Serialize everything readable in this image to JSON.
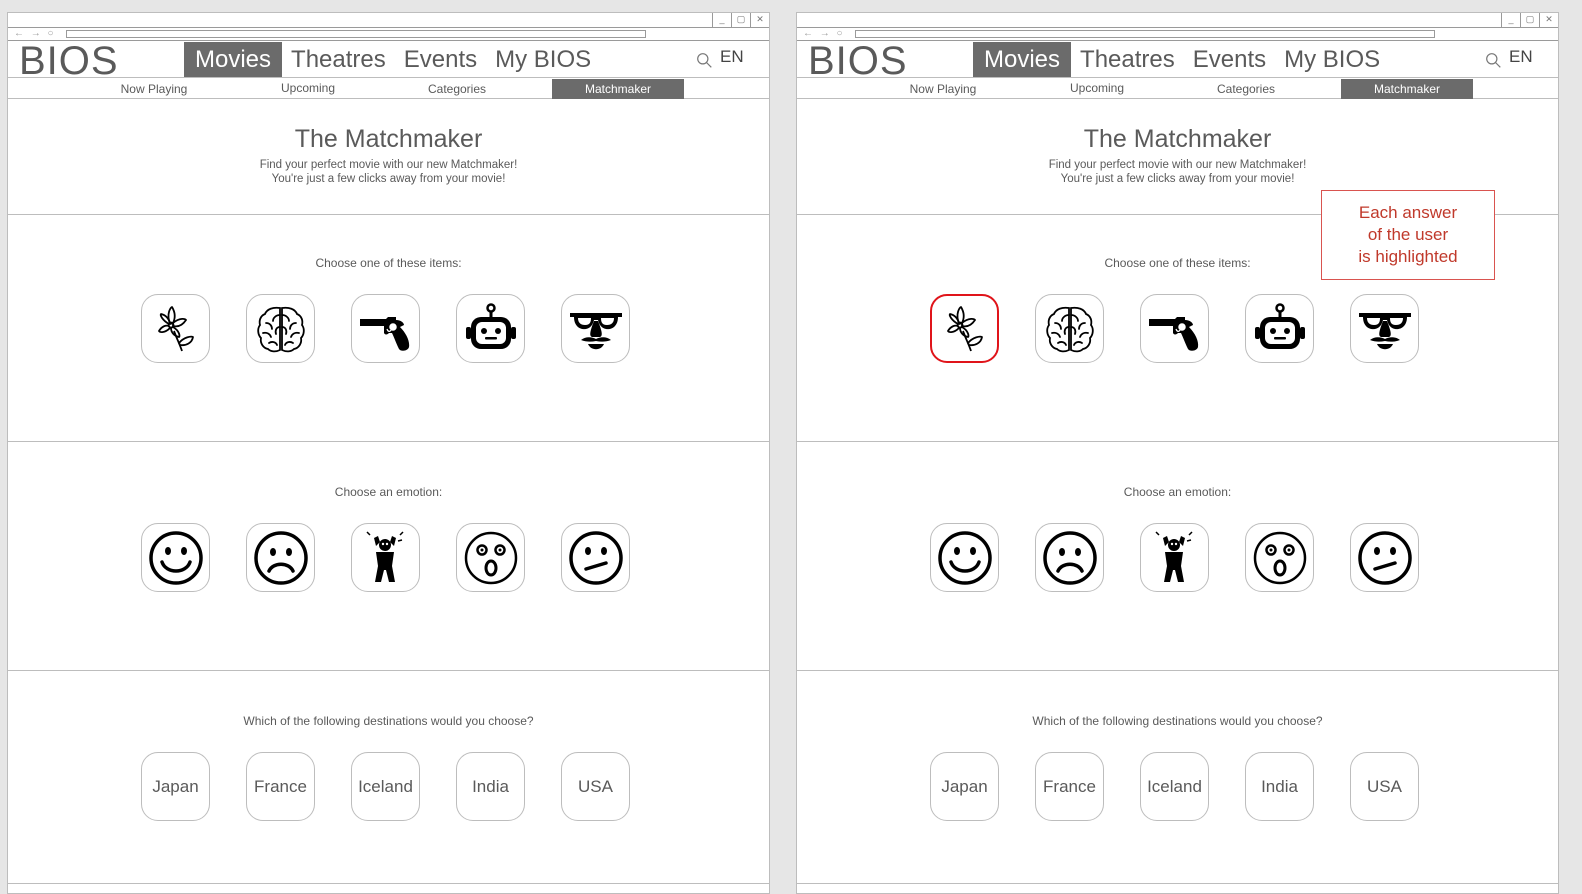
{
  "browser": {
    "nav_arrows": "← → ○",
    "win_buttons": [
      "_",
      "▢",
      "✕"
    ]
  },
  "site": {
    "logo": "BIOS",
    "main_nav": [
      "Movies",
      "Theatres",
      "Events",
      "My BIOS"
    ],
    "active_nav": "Movies",
    "language": "EN",
    "sub_nav": [
      "Now Playing",
      "Upcoming",
      "Categories",
      "Matchmaker"
    ],
    "active_sub": "Matchmaker"
  },
  "hero": {
    "title": "The Matchmaker",
    "line1": "Find your perfect movie with our new Matchmaker!",
    "line2": "You're just a few clicks away from your movie!"
  },
  "questions": {
    "items": {
      "prompt": "Choose one of these items:",
      "options": [
        "flower-icon",
        "brain-icon",
        "revolver-icon",
        "robot-icon",
        "disguise-glasses-icon"
      ]
    },
    "emotion": {
      "prompt": "Choose an emotion:",
      "options": [
        "happy-face-icon",
        "sad-face-icon",
        "scared-person-icon",
        "surprised-face-icon",
        "neutral-face-icon"
      ]
    },
    "destination": {
      "prompt": "Which of the following destinations would you choose?",
      "options": [
        "Japan",
        "France",
        "Iceland",
        "India",
        "USA"
      ]
    }
  },
  "annotation": {
    "line1": "Each answer",
    "line2": "of the user",
    "line3": "is highlighted",
    "color": "#c0392b"
  },
  "highlight_color": "#e0141a"
}
